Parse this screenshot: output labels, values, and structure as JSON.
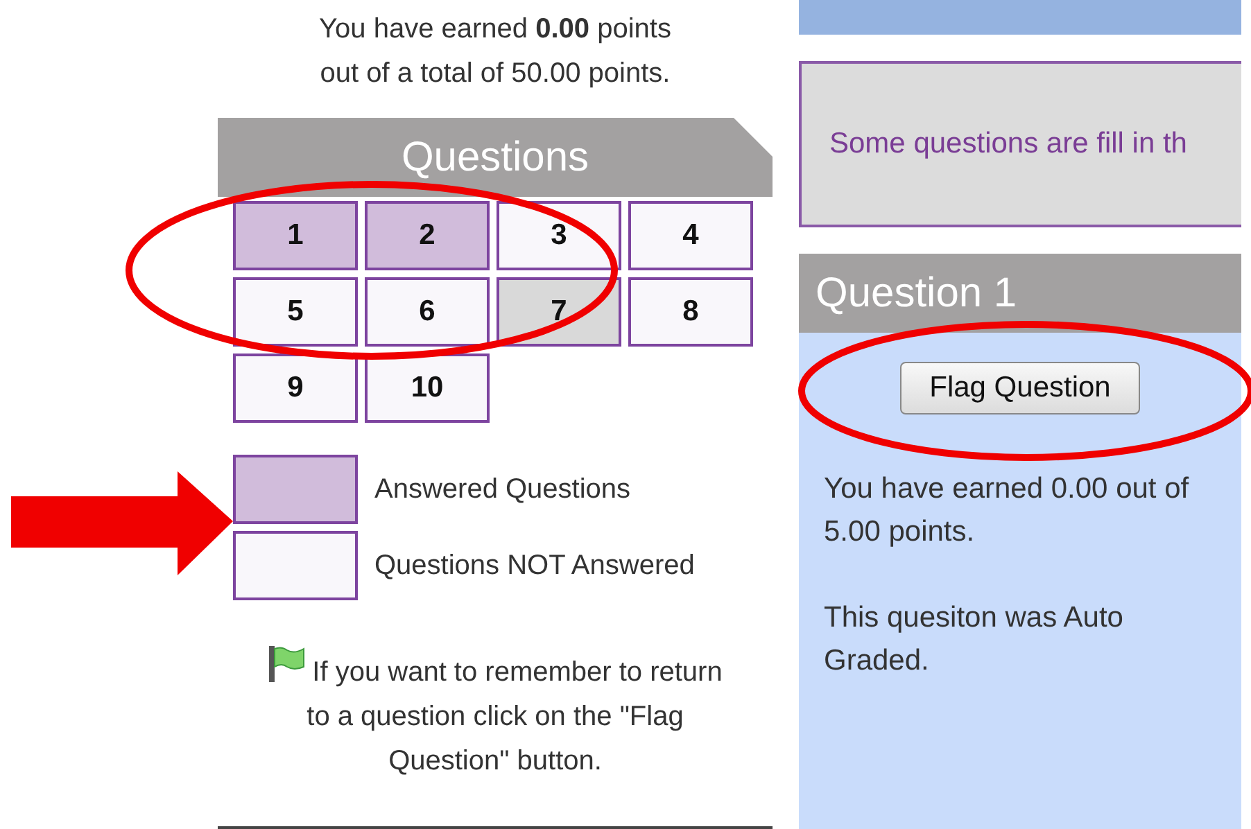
{
  "score": {
    "lines": [
      "You have earned **0.00** points",
      "out of a total of 50.00 points."
    ]
  },
  "questions_panel": {
    "title": "Questions",
    "questions": [
      {
        "label": "1",
        "answered": true,
        "current": false
      },
      {
        "label": "2",
        "answered": true,
        "current": false
      },
      {
        "label": "3",
        "answered": false,
        "current": false
      },
      {
        "label": "4",
        "answered": false,
        "current": false
      },
      {
        "label": "5",
        "answered": false,
        "current": false
      },
      {
        "label": "6",
        "answered": false,
        "current": false
      },
      {
        "label": "7",
        "answered": false,
        "current": true
      },
      {
        "label": "8",
        "answered": false,
        "current": false
      },
      {
        "label": "9",
        "answered": false,
        "current": false
      },
      {
        "label": "10",
        "answered": false,
        "current": false
      }
    ]
  },
  "legend": [
    {
      "answered": true,
      "label": "Answered Questions"
    },
    {
      "answered": false,
      "label": "Questions NOT Answered"
    }
  ],
  "flag_hint": "If you want to remember to return to a question click on the \"Flag Question\" button.",
  "notice": "Some questions are fill in th",
  "question": {
    "title": "Question 1",
    "flag_button": "Flag Question",
    "score_text": "You have earned 0.00 out of 5.00 points.",
    "grading_text": "This quesiton was Auto Graded."
  }
}
